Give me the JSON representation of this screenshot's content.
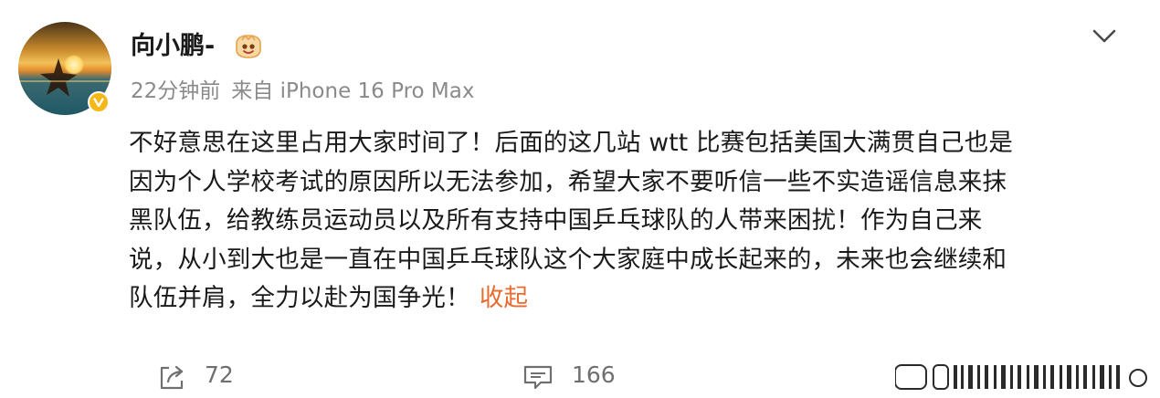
{
  "post": {
    "author": "向小鹏-",
    "time": "22分钟前",
    "source": "来自 iPhone 16 Pro Max",
    "lines": [
      "不好意思在这里占用大家时间了！后面的这几站 wtt 比赛包括美国大满贯自己也是",
      "因为个人学校考试的原因所以无法参加，希望大家不要听信一些不实造谣信息来抹",
      "黑队伍，给教练员运动员以及所有支持中国乒乓球队的人带来困扰！作为自己来",
      "说，从小到大也是一直在中国乒乓球队这个大家庭中成长起来的，未来也会继续和",
      "队伍并肩，全力以赴为国争光！"
    ],
    "collapse_label": "收起"
  },
  "actions": {
    "repost_count": "72",
    "comment_count": "166"
  },
  "colors": {
    "accent_link": "#e86a2e",
    "verified_badge": "#f6b817",
    "meta_text": "#8a8a8a"
  },
  "icons": {
    "repost": "share-arrow-icon",
    "comment": "comment-bubble-icon",
    "menu": "chevron-down-icon",
    "verified": "verified-v-icon"
  }
}
